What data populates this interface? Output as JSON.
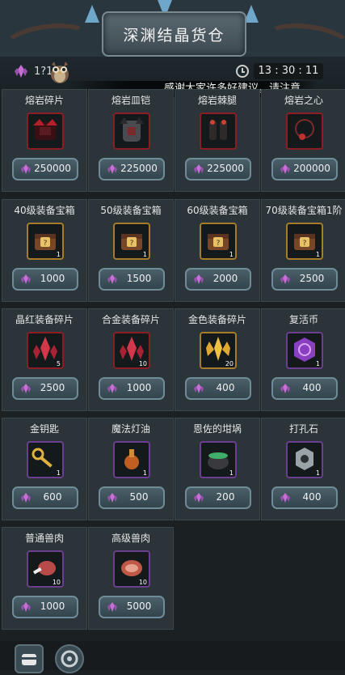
{
  "header": {
    "title": "深渊结晶货仓",
    "currency_count": "1?14",
    "time": "13 : 30 : 11",
    "notice": "感谢大家许多好建议，请注意"
  },
  "colors": {
    "gem": "#c86fd6",
    "price_button": "#3f535c",
    "card_bg": "#2b3438"
  },
  "items": [
    {
      "name": "熔岩碎片",
      "price": "250000",
      "qty": "",
      "icon": "lava-armor-icon",
      "frame": "red"
    },
    {
      "name": "熔岩皿铠",
      "price": "225000",
      "qty": "",
      "icon": "lava-chestplate-icon",
      "frame": "red"
    },
    {
      "name": "熔岩棘腿",
      "price": "225000",
      "qty": "",
      "icon": "lava-greaves-icon",
      "frame": "red"
    },
    {
      "name": "熔岩之心",
      "price": "200000",
      "qty": "",
      "icon": "lava-amulet-icon",
      "frame": "red"
    },
    {
      "name": "40级装备宝箱",
      "price": "1000",
      "qty": "1",
      "icon": "treasure-chest-icon",
      "frame": "gold"
    },
    {
      "name": "50级装备宝箱",
      "price": "1500",
      "qty": "1",
      "icon": "treasure-chest-icon",
      "frame": "gold"
    },
    {
      "name": "60级装备宝箱",
      "price": "2000",
      "qty": "1",
      "icon": "treasure-chest-icon",
      "frame": "gold"
    },
    {
      "name": "70级装备宝箱1阶",
      "price": "2500",
      "qty": "1",
      "icon": "treasure-chest-icon",
      "frame": "gold"
    },
    {
      "name": "晶红装备碎片",
      "price": "2500",
      "qty": "5",
      "icon": "red-crystal-shard-icon",
      "frame": "red"
    },
    {
      "name": "合金装备碎片",
      "price": "1000",
      "qty": "10",
      "icon": "red-crystal-shard-icon",
      "frame": "red"
    },
    {
      "name": "金色装备碎片",
      "price": "400",
      "qty": "20",
      "icon": "gold-crystal-shard-icon",
      "frame": "gold"
    },
    {
      "name": "复活币",
      "price": "400",
      "qty": "1",
      "icon": "revive-coin-icon",
      "frame": "purple"
    },
    {
      "name": "金钥匙",
      "price": "600",
      "qty": "1",
      "icon": "gold-key-icon",
      "frame": "purple"
    },
    {
      "name": "魔法灯油",
      "price": "500",
      "qty": "1",
      "icon": "lamp-oil-icon",
      "frame": "purple"
    },
    {
      "name": "恩佐的坩埚",
      "price": "200",
      "qty": "1",
      "icon": "cauldron-icon",
      "frame": "purple"
    },
    {
      "name": "打孔石",
      "price": "400",
      "qty": "1",
      "icon": "punch-stone-icon",
      "frame": "purple"
    },
    {
      "name": "普通兽肉",
      "price": "1000",
      "qty": "10",
      "icon": "meat-icon",
      "frame": "purple"
    },
    {
      "name": "高级兽肉",
      "price": "5000",
      "qty": "10",
      "icon": "steak-icon",
      "frame": "purple"
    }
  ],
  "bottom_tabs": [
    {
      "icon": "chest-tab-icon"
    },
    {
      "icon": "gear-tab-icon"
    }
  ]
}
